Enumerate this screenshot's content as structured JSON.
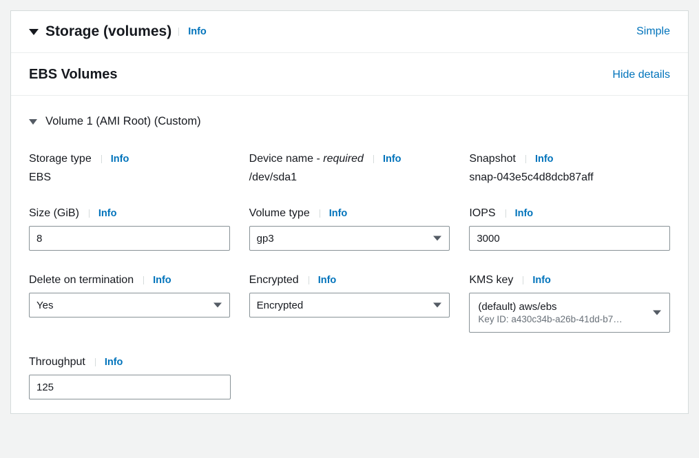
{
  "header": {
    "title": "Storage (volumes)",
    "info": "Info",
    "simple": "Simple"
  },
  "section": {
    "title": "EBS Volumes",
    "hide": "Hide details"
  },
  "volume": {
    "title": "Volume 1 (AMI Root) (Custom)",
    "fields": {
      "storage_type": {
        "label": "Storage type",
        "info": "Info",
        "value": "EBS"
      },
      "device_name": {
        "label": "Device name - ",
        "required": "required",
        "info": "Info",
        "value": "/dev/sda1"
      },
      "snapshot": {
        "label": "Snapshot",
        "info": "Info",
        "value": "snap-043e5c4d8dcb87aff"
      },
      "size": {
        "label": "Size (GiB)",
        "info": "Info",
        "value": "8"
      },
      "volume_type": {
        "label": "Volume type",
        "info": "Info",
        "value": "gp3"
      },
      "iops": {
        "label": "IOPS",
        "info": "Info",
        "value": "3000"
      },
      "delete_termination": {
        "label": "Delete on termination",
        "info": "Info",
        "value": "Yes"
      },
      "encrypted": {
        "label": "Encrypted",
        "info": "Info",
        "value": "Encrypted"
      },
      "kms": {
        "label": "KMS key",
        "info": "Info",
        "value": "(default) aws/ebs",
        "sub": "Key ID: a430c34b-a26b-41dd-b7…"
      },
      "throughput": {
        "label": "Throughput",
        "info": "Info",
        "value": "125"
      }
    }
  }
}
